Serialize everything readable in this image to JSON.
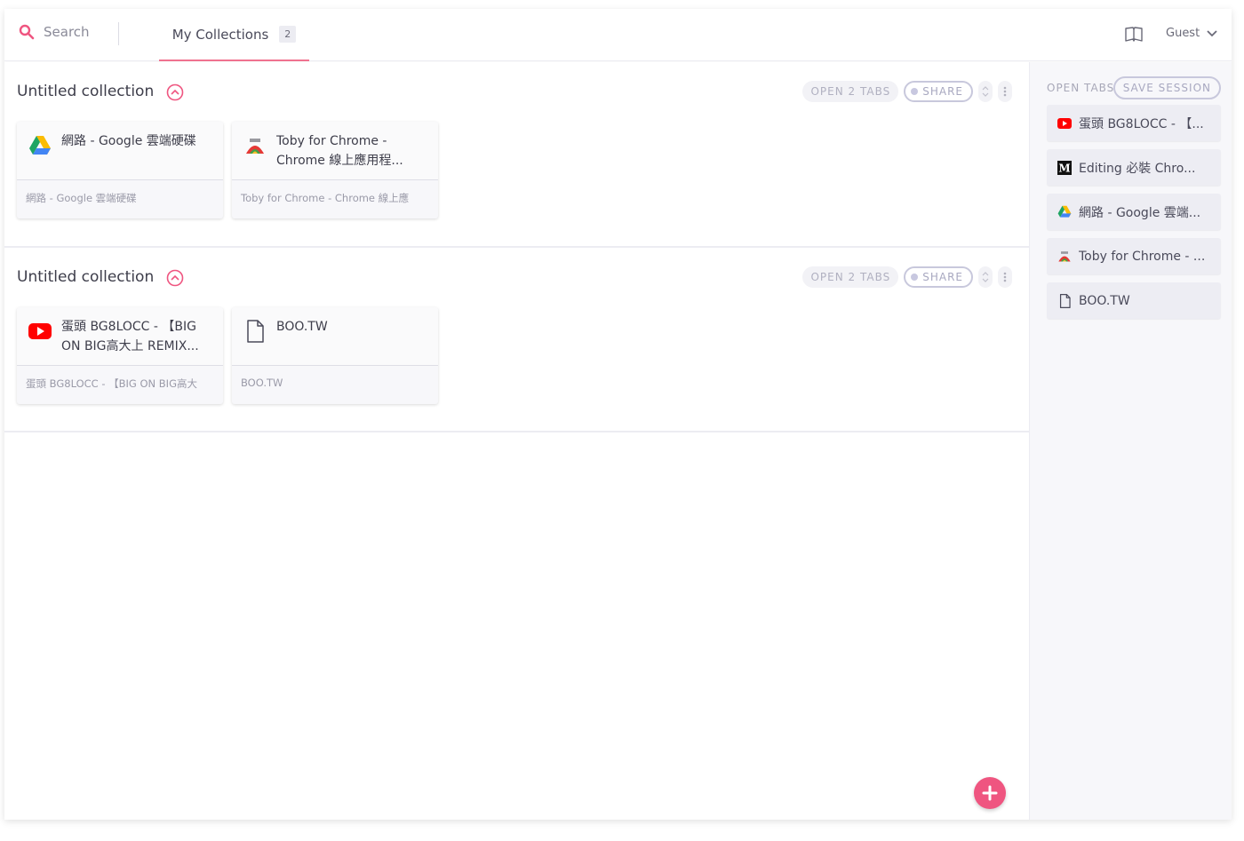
{
  "header": {
    "search_label": "Search",
    "tab_label": "My Collections",
    "tab_count": "2",
    "user_label": "Guest"
  },
  "collections": [
    {
      "title": "Untitled collection",
      "open_tabs_label": "OPEN 2 TABS",
      "share_label": "SHARE",
      "cards": [
        {
          "title": "網路 - Google 雲端硬碟",
          "subtitle": "網路 - Google 雲端硬碟",
          "icon": "google-drive-icon"
        },
        {
          "title": "Toby for Chrome - Chrome 線上應用程...",
          "subtitle": "Toby for Chrome - Chrome 線上應",
          "icon": "toby-icon"
        }
      ]
    },
    {
      "title": "Untitled collection",
      "open_tabs_label": "OPEN 2 TABS",
      "share_label": "SHARE",
      "cards": [
        {
          "title": "蛋頭 BG8LOCC - 【BIG ON BIG高大上 REMIX...",
          "subtitle": "蛋頭 BG8LOCC - 【BIG ON BIG高大",
          "icon": "youtube-icon"
        },
        {
          "title": "BOO.TW",
          "subtitle": "BOO.TW",
          "icon": "document-icon"
        }
      ]
    }
  ],
  "sidebar": {
    "open_tabs_label": "OPEN TABS",
    "save_session_label": "SAVE SESSION",
    "tabs": [
      {
        "label": "蛋頭 BG8LOCC - 【...",
        "icon": "youtube-icon"
      },
      {
        "label": "Editing 必裝 Chro...",
        "icon": "medium-icon"
      },
      {
        "label": "網路 - Google 雲端...",
        "icon": "google-drive-icon"
      },
      {
        "label": "Toby for Chrome - ...",
        "icon": "toby-icon"
      },
      {
        "label": "BOO.TW",
        "icon": "document-icon"
      }
    ]
  },
  "colors": {
    "accent": "#ef5580",
    "tab_underline": "#f0728f"
  }
}
